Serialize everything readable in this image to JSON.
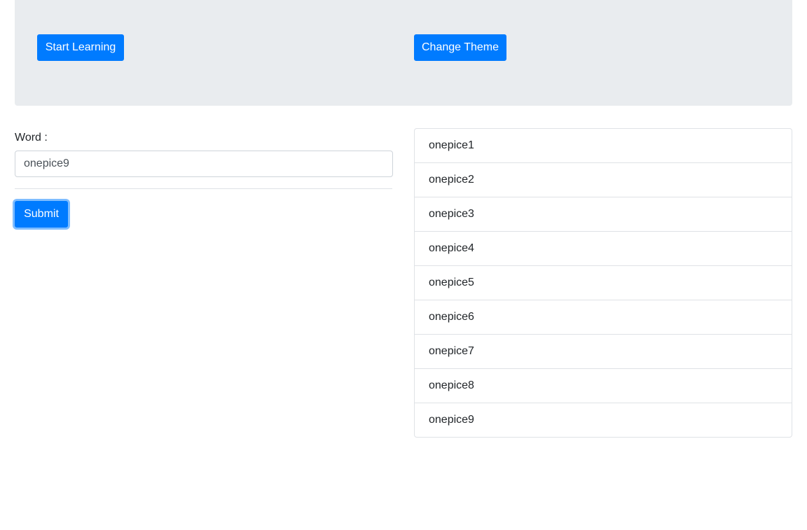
{
  "header": {
    "start_button_label": "Start Learning",
    "theme_button_label": "Change Theme"
  },
  "form": {
    "word_label": "Word :",
    "word_value": "onepice9",
    "submit_label": "Submit"
  },
  "words": [
    "onepice1",
    "onepice2",
    "onepice3",
    "onepice4",
    "onepice5",
    "onepice6",
    "onepice7",
    "onepice8",
    "onepice9"
  ],
  "colors": {
    "primary": "#007bff",
    "jumbotron": "#e9ecef"
  }
}
